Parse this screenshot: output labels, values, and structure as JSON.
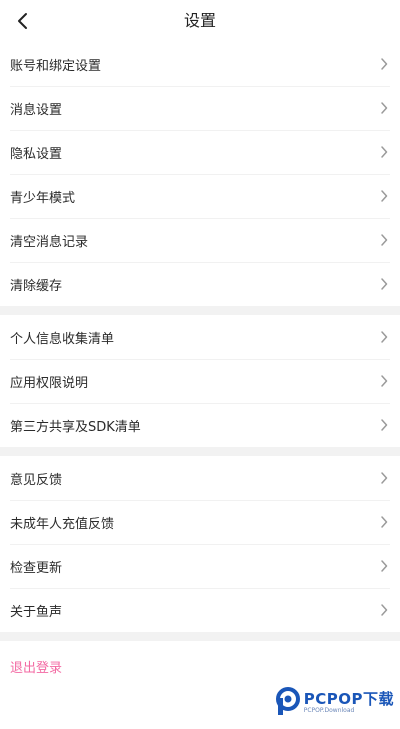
{
  "header": {
    "title": "设置",
    "back_icon": "chevron-left-icon"
  },
  "groups": [
    {
      "items": [
        "账号和绑定设置",
        "消息设置",
        "隐私设置",
        "青少年模式",
        "清空消息记录",
        "清除缓存"
      ]
    },
    {
      "items": [
        "个人信息收集清单",
        "应用权限说明",
        "第三方共享及SDK清单"
      ]
    },
    {
      "items": [
        "意见反馈",
        "未成年人充值反馈",
        "检查更新",
        "关于鱼声"
      ]
    }
  ],
  "logout": {
    "label": "退出登录",
    "color": "#f36aa3"
  },
  "watermark": {
    "text": "PCPOP下载",
    "sub": "PCPOP.Download"
  },
  "colors": {
    "separator": "#f2f2f2",
    "chevron": "#9a9a9a"
  }
}
